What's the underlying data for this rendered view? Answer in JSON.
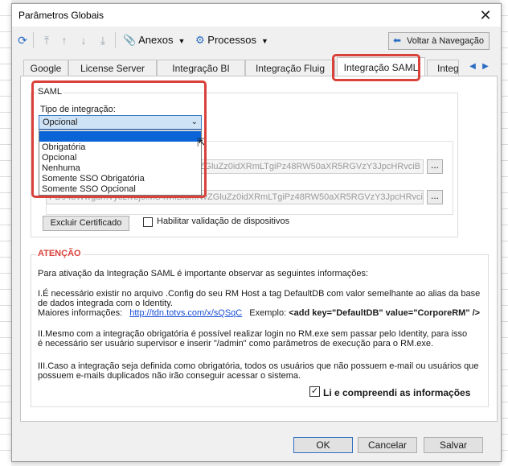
{
  "window": {
    "title": "Parâmetros Globais"
  },
  "toolbar": {
    "anexos": "Anexos",
    "processos": "Processos",
    "back_label": "Voltar à Navegação"
  },
  "tabs": [
    {
      "label": "Google"
    },
    {
      "label": "License Server"
    },
    {
      "label": "Integração BI"
    },
    {
      "label": "Integração Fluig"
    },
    {
      "label": "Integração SAML",
      "active": true
    },
    {
      "label": "Integ"
    }
  ],
  "saml": {
    "group_label": "SAML",
    "tipo_label": "Tipo de integração:",
    "selected_value": "Opcional",
    "options": [
      "",
      "Obrigatória",
      "Opcional",
      "Nenhuma",
      "Somente SSO Obrigatória",
      "Somente SSO Opcional"
    ],
    "cert1_visible": "ZGluZz0idXRmLTgiPz48RW50aXR5RGVzY3JpcHRvciB",
    "cert2_visible": "PD94bWwgdmVyc2lvbj0iMS4wIiBlbmNvZGluZz0idXRmLTgiPz48RW50aXR5RGVzY3JpcHRvciB",
    "dots": "...",
    "excluir": "Excluir Certificado",
    "habilitar": "Habilitar validação de dispositivos"
  },
  "attention": {
    "label": "ATENÇÃO",
    "intro": "Para ativação da Integração SAML é importante observar as seguintes informações:",
    "p1_line1": "I.É necessário existir no arquivo .Config do seu RM Host a tag DefaultDB com valor semelhante ao alias da base",
    "p1_line2": "de dados integrada com o Identity.",
    "more_info": "Maiores informações:",
    "link": "http://tdn.totvs.com/x/sQSqC",
    "example_label": "Exemplo:",
    "example_code": "<add key=\"DefaultDB\" value=\"CorporeRM\" />",
    "p2_line1": "II.Mesmo com a integração obrigatória é possível realizar login no RM.exe sem passar pelo Identity, para isso",
    "p2_line2": "é necessário ser usuário supervisor e inserir \"/admin\" como parâmetros de execução para o RM.exe.",
    "p3_line1": "III.Caso a integração seja definida como obrigatória, todos os usuários que não possuem e-mail ou usuários que",
    "p3_line2": "possuem e-mails duplicados não irão conseguir acessar o sistema.",
    "ack": "Li e compreendi as informações",
    "ack_checked": true
  },
  "buttons": {
    "ok": "OK",
    "cancel": "Cancelar",
    "save": "Salvar"
  },
  "colors": {
    "highlight": "#d9413a",
    "selection": "#0a64d8",
    "link": "#1a4fd6"
  }
}
